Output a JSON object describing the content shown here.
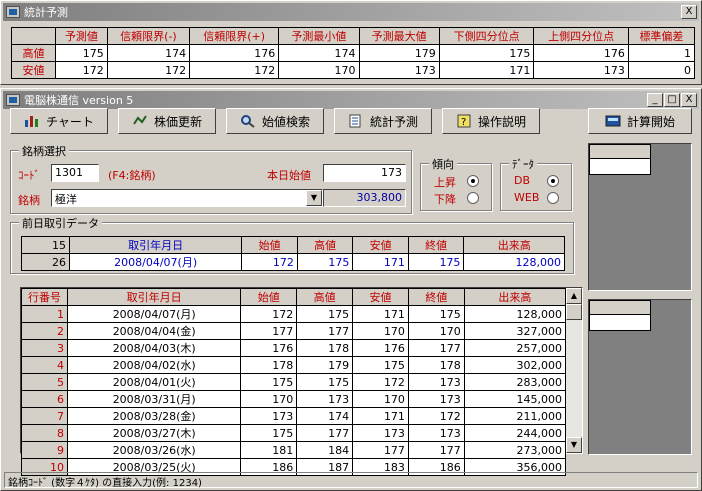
{
  "stats_window": {
    "title": "統計予測",
    "close": "X",
    "headers": [
      "予測値",
      "信頼限界(-)",
      "信頼限界(+)",
      "予測最小値",
      "予測最大値",
      "下側四分位点",
      "上側四分位点",
      "標準偏差"
    ],
    "rows": [
      {
        "label": "高値",
        "values": [
          "175",
          "174",
          "176",
          "174",
          "179",
          "175",
          "176",
          "1"
        ]
      },
      {
        "label": "安値",
        "values": [
          "172",
          "172",
          "172",
          "170",
          "173",
          "171",
          "173",
          "0"
        ]
      }
    ]
  },
  "main_window": {
    "title": "電脳株通信 version 5",
    "toolbar": [
      {
        "label": "チャート",
        "icon": "chart-icon"
      },
      {
        "label": "株価更新",
        "icon": "update-icon"
      },
      {
        "label": "始値検索",
        "icon": "search-icon"
      },
      {
        "label": "統計予測",
        "icon": "stats-icon"
      },
      {
        "label": "操作説明",
        "icon": "help-icon"
      },
      {
        "label": "計算開始",
        "icon": "calc-icon"
      }
    ],
    "stock_group": {
      "title": "銘柄選択",
      "code_label": "ｺｰﾄﾞ",
      "code_value": "1301",
      "code_hint": "(F4:銘柄)",
      "name_label": "銘柄",
      "name_value": "極洋",
      "open_label": "本日始値",
      "open_value": "173",
      "volume_value": "303,800"
    },
    "trend_group": {
      "title": "傾向",
      "options": [
        "上昇",
        "下降"
      ],
      "selected": 0
    },
    "data_group": {
      "title": "ﾃﾞｰﾀ",
      "options": [
        "DB",
        "WEB"
      ],
      "selected": 0
    },
    "prev_group": {
      "title": "前日取引データ",
      "headers": [
        "15",
        "取引年月日",
        "始値",
        "高値",
        "安値",
        "終値",
        "出来高"
      ],
      "row": [
        "26",
        "2008/04/07(月)",
        "172",
        "175",
        "171",
        "175",
        "128,000"
      ]
    },
    "history": {
      "headers": [
        "行番号",
        "取引年月日",
        "始値",
        "高値",
        "安値",
        "終値",
        "出来高"
      ],
      "rows": [
        [
          "1",
          "2008/04/07(月)",
          "172",
          "175",
          "171",
          "175",
          "128,000"
        ],
        [
          "2",
          "2008/04/04(金)",
          "177",
          "177",
          "170",
          "170",
          "327,000"
        ],
        [
          "3",
          "2008/04/03(木)",
          "176",
          "178",
          "176",
          "177",
          "257,000"
        ],
        [
          "4",
          "2008/04/02(水)",
          "178",
          "179",
          "175",
          "178",
          "302,000"
        ],
        [
          "5",
          "2008/04/01(火)",
          "175",
          "175",
          "172",
          "173",
          "283,000"
        ],
        [
          "6",
          "2008/03/31(月)",
          "170",
          "173",
          "170",
          "173",
          "145,000"
        ],
        [
          "7",
          "2008/03/28(金)",
          "173",
          "174",
          "171",
          "172",
          "211,000"
        ],
        [
          "8",
          "2008/03/27(木)",
          "175",
          "177",
          "173",
          "173",
          "244,000"
        ],
        [
          "9",
          "2008/03/26(水)",
          "181",
          "184",
          "177",
          "177",
          "273,000"
        ],
        [
          "10",
          "2008/03/25(火)",
          "186",
          "187",
          "183",
          "186",
          "356,000"
        ]
      ]
    },
    "status": "銘柄ｺｰﾄﾞ (数字４ｹﾀ) の直接入力(例: 1234)"
  },
  "colors": {
    "header_text": "#c00000",
    "date_text": "#0000c0",
    "panel_gray": "#808080"
  }
}
